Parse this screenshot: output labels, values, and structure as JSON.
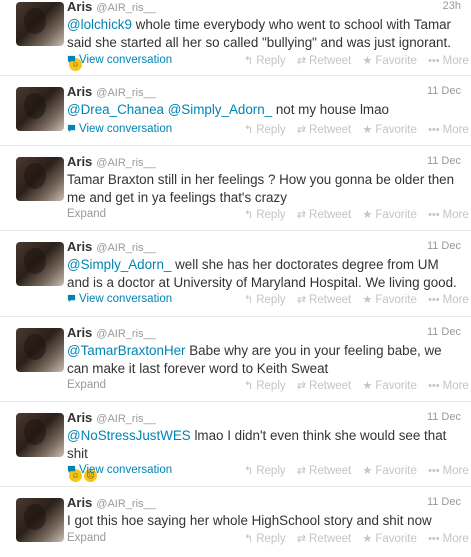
{
  "actions": {
    "reply": "Reply",
    "retweet": "Retweet",
    "favorite": "Favorite",
    "more": "More",
    "reply_icon": "reply-icon",
    "retweet_icon": "retweet-icon",
    "favorite_icon": "star-icon",
    "more_icon": "dots-icon"
  },
  "tweets": [
    {
      "name": "Aris",
      "handle": "@AIR_ris__",
      "date": "23h",
      "mention": "@lolchick9",
      "text": " whole time everybody who went to school with Tamar said she started all her so called \"bullying\" and was just ignorant.",
      "link": "View conversation"
    },
    {
      "name": "Aris",
      "handle": "@AIR_ris__",
      "date": "11 Dec",
      "mention": "@Drea_Chanea",
      "mention2": "@Simply_Adorn_",
      "text": " not my house lmao",
      "link": "View conversation"
    },
    {
      "name": "Aris",
      "handle": "@AIR_ris__",
      "date": "11 Dec",
      "text": "Tamar Braxton still in her feelings ? How you gonna be older then me and get in ya feelings that's crazy",
      "link": "Expand"
    },
    {
      "name": "Aris",
      "handle": "@AIR_ris__",
      "date": "11 Dec",
      "mention": "@Simply_Adorn_",
      "text": " well she has her doctorates degree from UM and is a doctor at University of Maryland Hospital. We living good.",
      "link": "View conversation"
    },
    {
      "name": "Aris",
      "handle": "@AIR_ris__",
      "date": "11 Dec",
      "mention": "@TamarBraxtonHer",
      "text": " Babe why are you in your feeling babe, we can make it last forever word to Keith Sweat",
      "link": "Expand"
    },
    {
      "name": "Aris",
      "handle": "@AIR_ris__",
      "date": "11 Dec",
      "mention": "@NoStressJustWES",
      "text": " lmao I didn't even think she would see that shit",
      "link": "View conversation"
    },
    {
      "name": "Aris",
      "handle": "@AIR_ris__",
      "date": "11 Dec",
      "text": "I got this hoe saying her whole HighSchool story and shit now",
      "link": "Expand"
    }
  ]
}
